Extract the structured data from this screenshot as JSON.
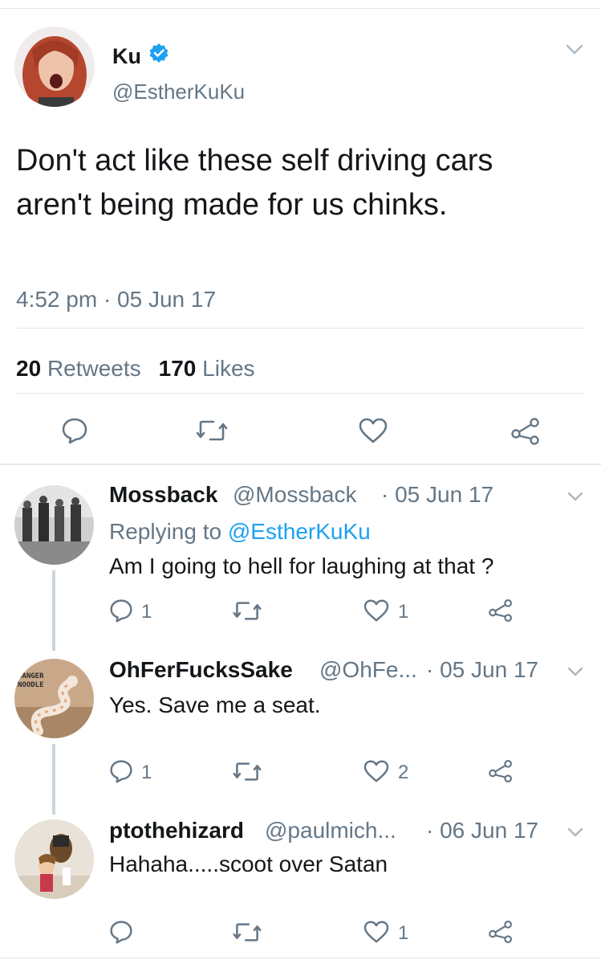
{
  "main": {
    "display_name": "Ku",
    "handle": "@EstherKuKu",
    "text": "Don't act like these self driving cars aren't being made for us chinks.",
    "timestamp": "4:52 pm · 05 Jun 17",
    "retweets_count": "20",
    "retweets_label": "Retweets",
    "likes_count": "170",
    "likes_label": "Likes"
  },
  "replies": [
    {
      "name": "Mossback",
      "handle": "@Mossback",
      "date": "· 05 Jun 17",
      "replying_prefix": "Replying to",
      "replying_handle": "@EstherKuKu",
      "text": "Am I going to hell for laughing at that ?",
      "reply_count": "1",
      "like_count": "1"
    },
    {
      "name": "OhFerFucksSake",
      "handle": "@OhFe...",
      "date": "· 05 Jun 17",
      "avatar_text_1": "DANGER",
      "avatar_text_2": "NOODLE",
      "text": "Yes.  Save me a seat.",
      "reply_count": "1",
      "like_count": "2"
    },
    {
      "name": "ptothehizard",
      "handle": "@paulmich...",
      "date": "· 06 Jun 17",
      "text": "Hahaha.....scoot over Satan",
      "like_count": "1"
    }
  ],
  "colors": {
    "accent": "#1da1f2",
    "secondary_text": "#657786",
    "divider": "#e1e8ed",
    "icon": "#657786"
  },
  "icons": [
    "verified-badge-icon",
    "chevron-down-icon",
    "reply-icon",
    "retweet-icon",
    "like-icon",
    "share-icon"
  ]
}
